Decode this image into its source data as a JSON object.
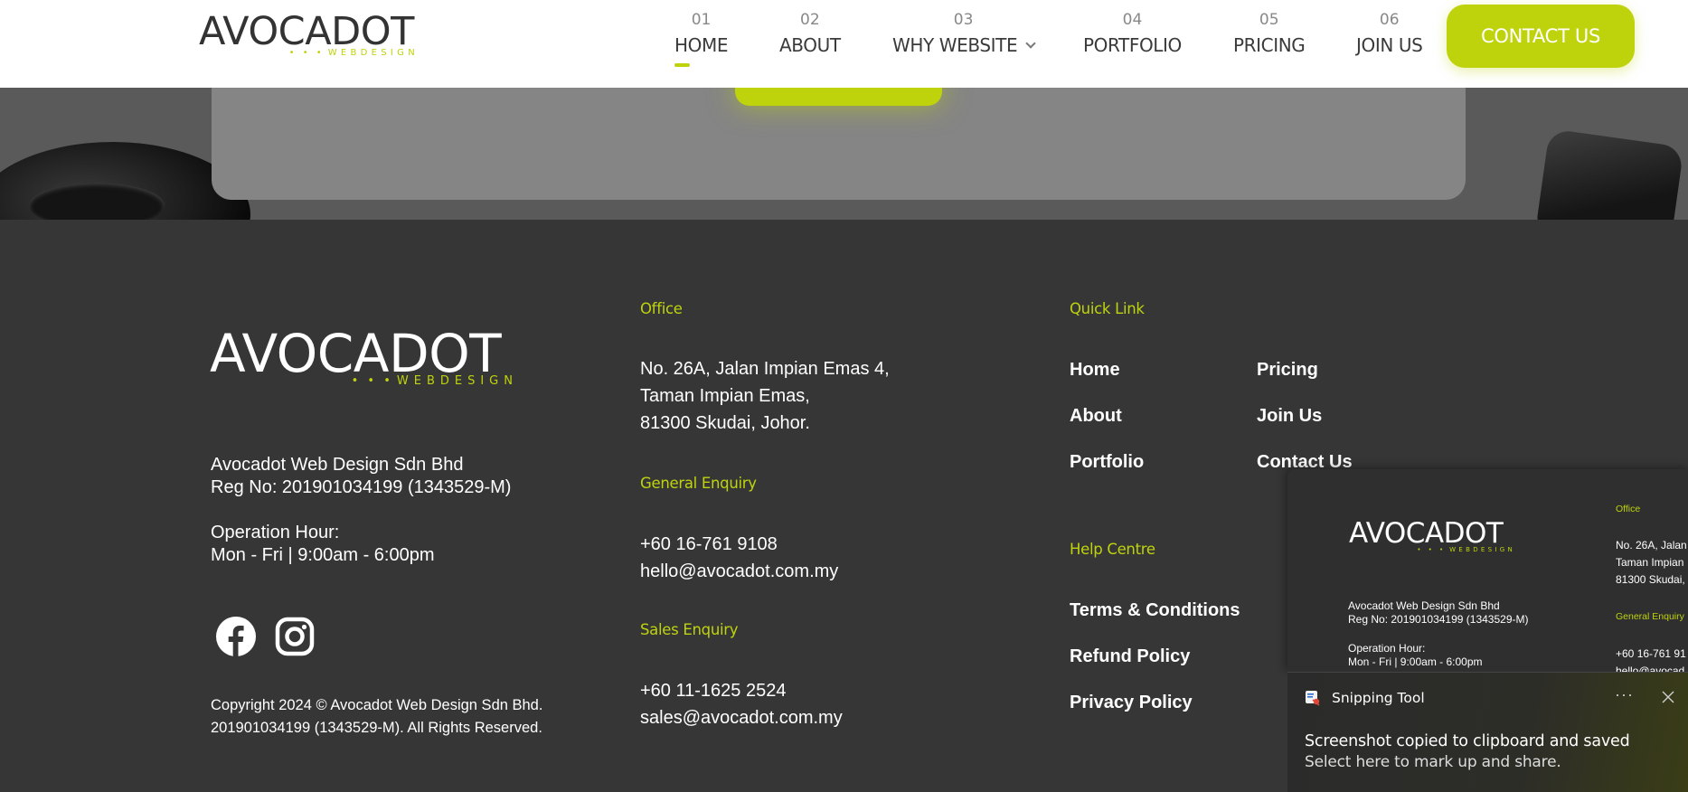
{
  "brand": {
    "name": "AVOCADOT",
    "tagline": "WEBDESIGN",
    "dots": "• • •",
    "accent": "#bfd30d",
    "dark": "#333333"
  },
  "nav": {
    "items": [
      {
        "num": "01",
        "label": "HOME",
        "active": true
      },
      {
        "num": "02",
        "label": "ABOUT"
      },
      {
        "num": "03",
        "label": "WHY WEBSITE",
        "has_dropdown": true
      },
      {
        "num": "04",
        "label": "PORTFOLIO"
      },
      {
        "num": "05",
        "label": "PRICING"
      },
      {
        "num": "06",
        "label": "JOIN US"
      }
    ],
    "cta": "CONTACT US"
  },
  "footer": {
    "company": "Avocadot Web Design Sdn Bhd",
    "reg": "Reg No: 201901034199 (1343529-M)",
    "hours_label": "Operation Hour:",
    "hours": "Mon - Fri | 9:00am - 6:00pm",
    "social": [
      {
        "icon": "facebook-icon"
      },
      {
        "icon": "instagram-icon"
      }
    ],
    "copyright_1": "Copyright 2024 © Avocadot Web Design Sdn Bhd.",
    "copyright_2": "201901034199 (1343529-M). All Rights Reserved.",
    "office": {
      "heading": "Office",
      "lines": [
        "No. 26A, Jalan Impian Emas 4,",
        "Taman Impian Emas,",
        "81300 Skudai, Johor."
      ]
    },
    "general": {
      "heading": "General Enquiry",
      "phone": "+60 16-761 9108",
      "email": "hello@avocadot.com.my"
    },
    "sales": {
      "heading": "Sales Enquiry",
      "phone": "+60 11-1625 2524",
      "email": "sales@avocadot.com.my"
    },
    "quick_link": {
      "heading": "Quick Link",
      "col1": [
        "Home",
        "About",
        "Portfolio"
      ],
      "col2": [
        "Pricing",
        "Join Us",
        "Contact Us"
      ]
    },
    "help": {
      "heading": "Help Centre",
      "links": [
        "Terms & Conditions",
        "Refund Policy",
        "Privacy Policy"
      ]
    }
  },
  "preview": {
    "office_heading": "Office",
    "office_lines": [
      "No. 26A, Jalan",
      "Taman Impian",
      "81300 Skudai,"
    ],
    "general_heading": "General Enquiry",
    "phone": "+60 16-761 91",
    "email_partial": "hello@avocad"
  },
  "toast": {
    "app": "Snipping Tool",
    "more": "···",
    "title": "Screenshot copied to clipboard and saved",
    "subtitle": "Select here to mark up and share."
  }
}
